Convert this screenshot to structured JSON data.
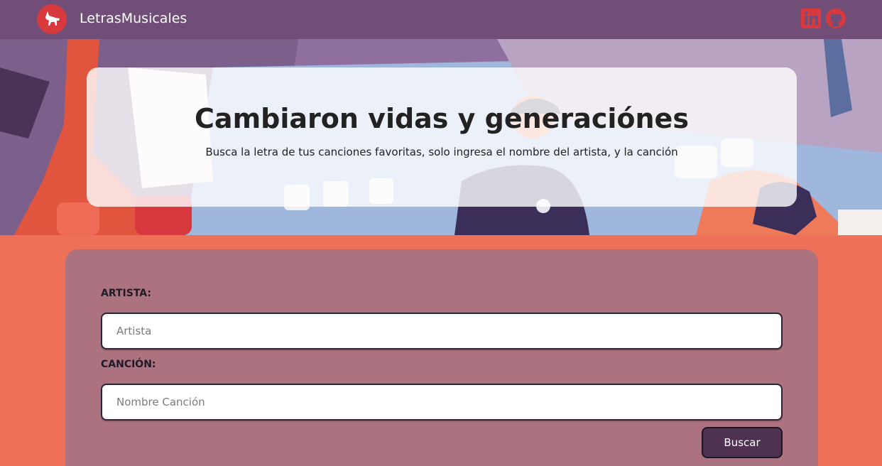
{
  "navbar": {
    "brand": "LetrasMusicales",
    "logo_icon": "fox-icon",
    "social": [
      "linkedin-icon",
      "github-icon"
    ],
    "colors": {
      "background": "#704e77",
      "logo": "#d8393e",
      "social": "#d8393e"
    }
  },
  "hero": {
    "title": "Cambiaron vidas y generaciónes",
    "subtitle": "Busca la letra de tus canciones favoritas, solo ingresa el nombre del artista, y la canción"
  },
  "form": {
    "artist_label": "ARTISTA:",
    "artist_placeholder": "Artista",
    "song_label": "CANCIÓN:",
    "song_placeholder": "Nombre Canción",
    "submit_label": "Buscar",
    "colors": {
      "page": "#ef7059",
      "card": "#ac727f",
      "button": "#4f3152"
    }
  }
}
